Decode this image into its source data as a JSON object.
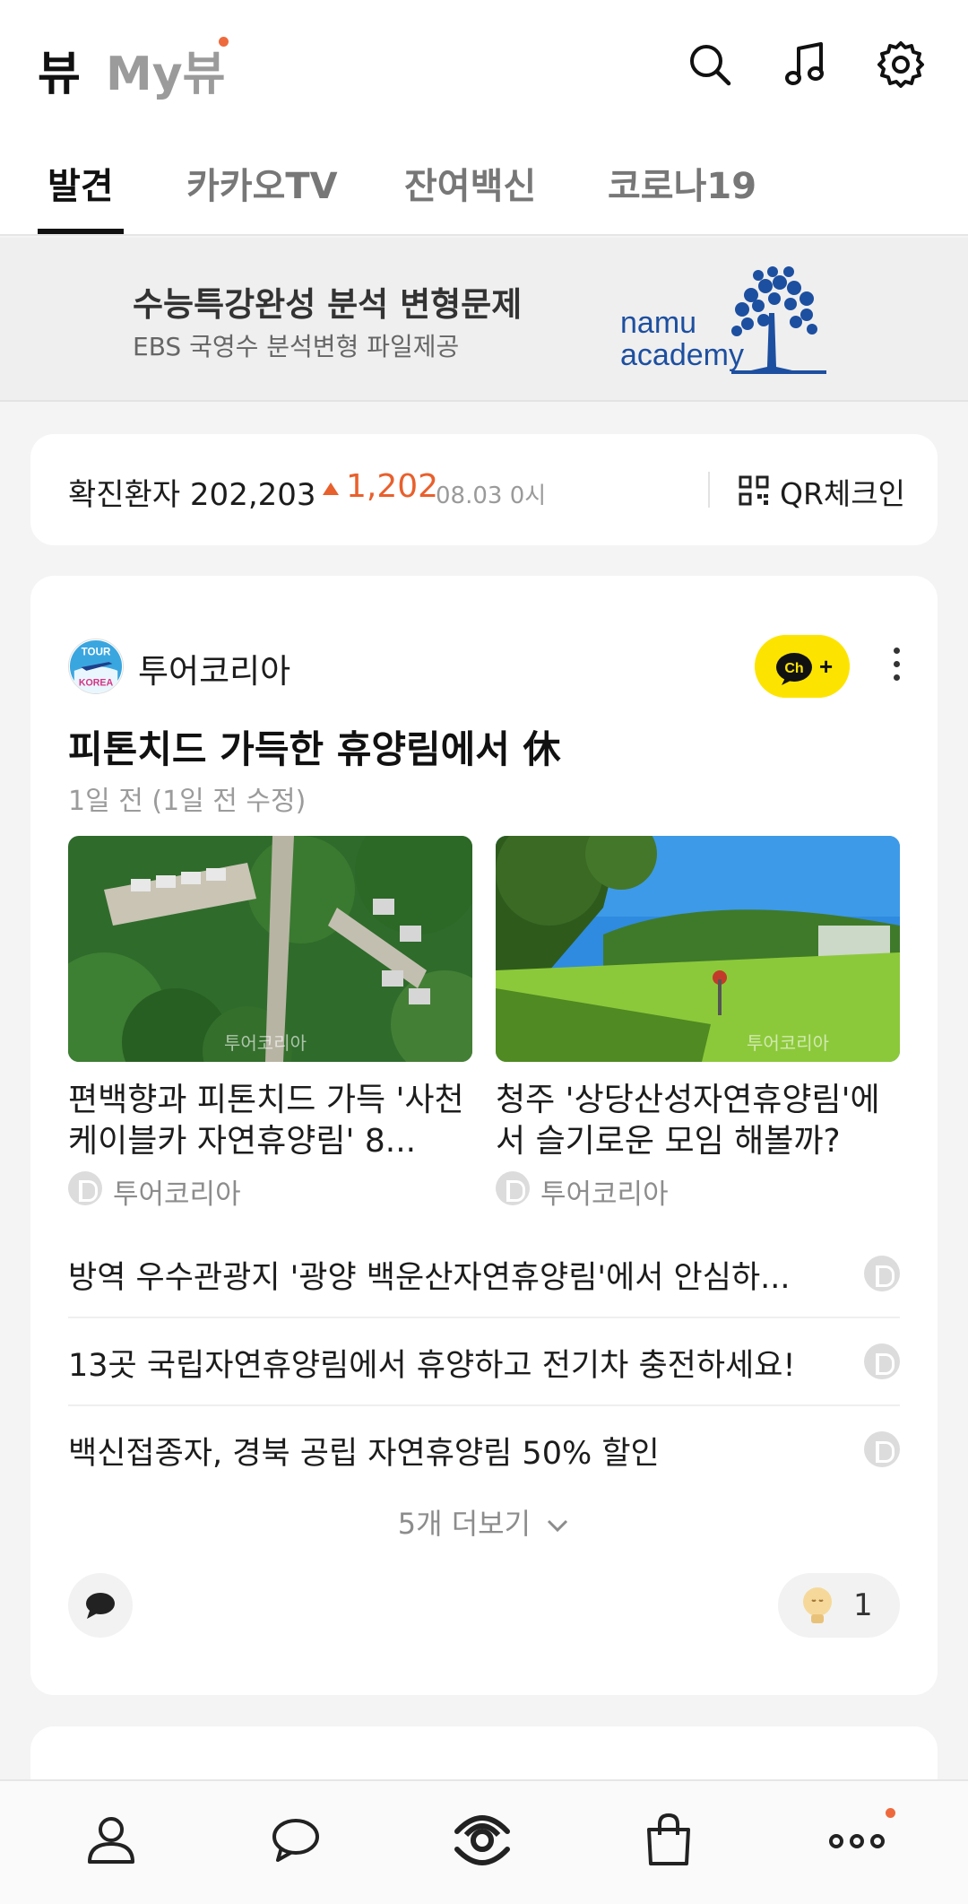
{
  "header": {
    "brand": "뷰",
    "myview": "My뷰",
    "icons": [
      "search-icon",
      "music-icon",
      "gear-icon"
    ]
  },
  "tabs": [
    {
      "label": "발견",
      "active": true
    },
    {
      "label": "카카오TV",
      "active": false
    },
    {
      "label": "잔여백신",
      "active": false
    },
    {
      "label": "코로나19",
      "active": false
    }
  ],
  "ad": {
    "title": "수능특강완성 분석 변형문제",
    "subtitle": "EBS 국영수 분석변형 파일제공",
    "logo_line1": "namu",
    "logo_line2": "academy"
  },
  "covid": {
    "label": "확진환자 202,203",
    "delta": "1,202",
    "date": "08.03 0시",
    "qr_label": "QR체크인"
  },
  "card": {
    "publisher": "투어코리아",
    "avatar_text_top": "TOUR",
    "avatar_text_bottom": "KOREA",
    "channel_button": "Ch+",
    "title": "피톤치드 가득한 휴양림에서 休",
    "time": "1일 전 (1일 전 수정)",
    "thumbs": [
      {
        "title": "편백향과 피톤치드 가득 '사천 케이블카 자연휴양림' 8...",
        "source": "투어코리아",
        "watermark": "투어코리아"
      },
      {
        "title": "청주 '상당산성자연휴양림'에서 슬기로운 모임 해볼까?",
        "source": "투어코리아",
        "watermark": "투어코리아"
      }
    ],
    "links": [
      "방역 우수관광지 '광양 백운산자연휴양림'에서 안심하...",
      "13곳 국립자연휴양림에서 휴양하고 전기차 충전하세요!",
      "백신접종자, 경북 공립 자연휴양림 50% 할인"
    ],
    "more": "5개 더보기",
    "like_count": "1"
  },
  "bottom_nav": [
    "person-icon",
    "chat-icon",
    "view-icon",
    "shopping-bag-icon",
    "more-icon"
  ],
  "colors": {
    "accent": "#e8602c",
    "kakao_yellow": "#fde400"
  }
}
